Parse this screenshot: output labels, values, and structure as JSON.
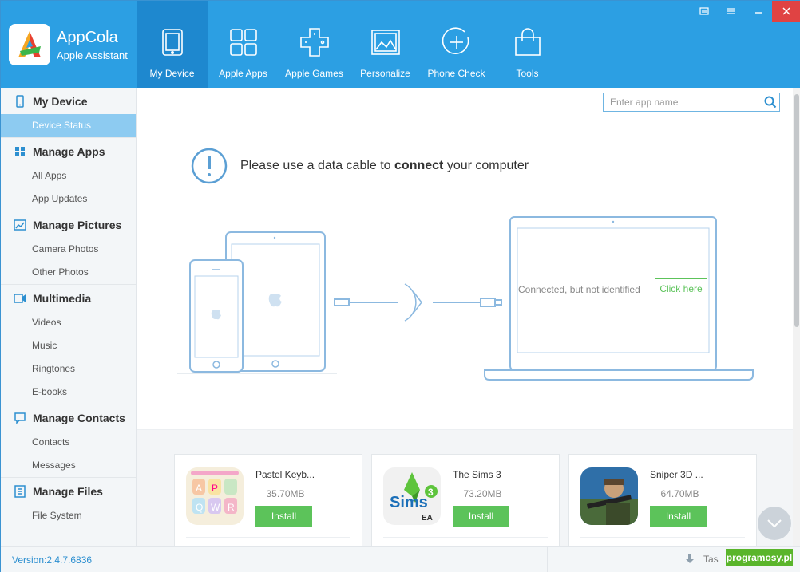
{
  "app": {
    "name": "AppCola",
    "subtitle": "Apple Assistant",
    "version": "Version:2.4.7.6836",
    "task_label": "Tas",
    "watermark": "programosy.pl"
  },
  "nav": [
    {
      "label": "My Device",
      "icon": "tablet-icon",
      "active": true
    },
    {
      "label": "Apple Apps",
      "icon": "grid-icon",
      "active": false
    },
    {
      "label": "Apple Games",
      "icon": "gamepad-icon",
      "active": false
    },
    {
      "label": "Personalize",
      "icon": "image-icon",
      "active": false
    },
    {
      "label": "Phone Check",
      "icon": "plus-circle-icon",
      "active": false
    },
    {
      "label": "Tools",
      "icon": "bag-icon",
      "active": false
    }
  ],
  "sidebar": [
    {
      "title": "My Device",
      "icon": "phone-icon",
      "items": [
        "Device Status"
      ]
    },
    {
      "title": "Manage Apps",
      "icon": "apps-icon",
      "items": [
        "All Apps",
        "App Updates"
      ]
    },
    {
      "title": "Manage Pictures",
      "icon": "pictures-icon",
      "items": [
        "Camera Photos",
        "Other Photos"
      ]
    },
    {
      "title": "Multimedia",
      "icon": "video-icon",
      "items": [
        "Videos",
        "Music",
        "Ringtones",
        "E-books"
      ]
    },
    {
      "title": "Manage Contacts",
      "icon": "chat-icon",
      "items": [
        "Contacts",
        "Messages"
      ]
    },
    {
      "title": "Manage Files",
      "icon": "file-icon",
      "items": [
        "File System"
      ]
    }
  ],
  "sidebar_active": "Device Status",
  "search": {
    "placeholder": "Enter app name",
    "value": ""
  },
  "message": {
    "prefix": "Please use a data cable to ",
    "bold": "connect",
    "suffix": " your computer"
  },
  "laptop": {
    "status": "Connected, but not identified",
    "button": "Click here"
  },
  "apps": [
    {
      "name": "Pastel Keyb...",
      "size": "35.70MB",
      "button": "Install",
      "icon": "keyboard-app-icon"
    },
    {
      "name": "The Sims 3",
      "size": "73.20MB",
      "button": "Install",
      "icon": "sims-app-icon"
    },
    {
      "name": "Sniper 3D ...",
      "size": "64.70MB",
      "button": "Install",
      "icon": "sniper-app-icon"
    }
  ],
  "colors": {
    "accent": "#2c9fe3",
    "active_nav": "#1e88cf",
    "install": "#5cc35a",
    "sidebar_active": "#8dcbf1"
  }
}
